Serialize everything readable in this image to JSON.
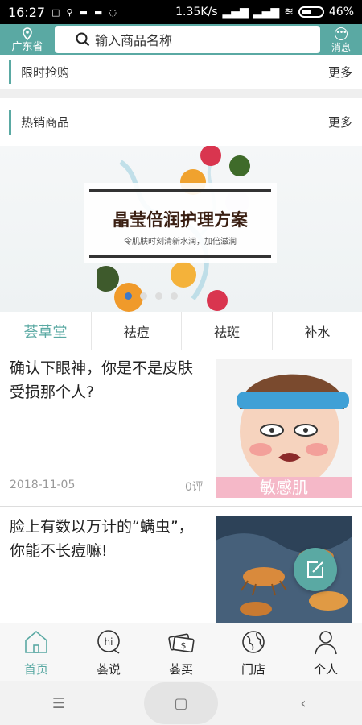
{
  "status_bar": {
    "time": "16:27",
    "speed": "1.35K/s",
    "battery": "46%"
  },
  "header": {
    "location": "广东省",
    "search_placeholder": "输入商品名称",
    "message": "消息"
  },
  "sections": [
    {
      "title": "限时抢购",
      "more": "更多"
    },
    {
      "title": "热销商品",
      "more": "更多"
    }
  ],
  "banner": {
    "title": "晶莹倍润护理方案",
    "subtitle": "令肌肤时刻清新水润，加倍滋润",
    "slide_count": 4,
    "active_slide": 2
  },
  "category_tabs": {
    "brand": "荟草堂",
    "items": [
      "祛痘",
      "祛斑",
      "补水"
    ]
  },
  "articles": [
    {
      "title": "确认下眼神，你是不是皮肤受损那个人?",
      "date": "2018-11-05",
      "comments": "0评",
      "image_caption": "敏感肌"
    },
    {
      "title": "脸上有数以万计的“螨虫”，你能不长痘嘛!"
    }
  ],
  "bottom_nav": [
    {
      "label": "首页",
      "icon": "home-icon",
      "active": true
    },
    {
      "label": "荟说",
      "icon": "chat-icon",
      "active": false
    },
    {
      "label": "荟买",
      "icon": "money-icon",
      "active": false
    },
    {
      "label": "门店",
      "icon": "globe-icon",
      "active": false
    },
    {
      "label": "个人",
      "icon": "user-icon",
      "active": false
    }
  ],
  "colors": {
    "accent": "#5aa9a3",
    "status_bar": "#000000",
    "active_dot": "#3e79c8"
  }
}
